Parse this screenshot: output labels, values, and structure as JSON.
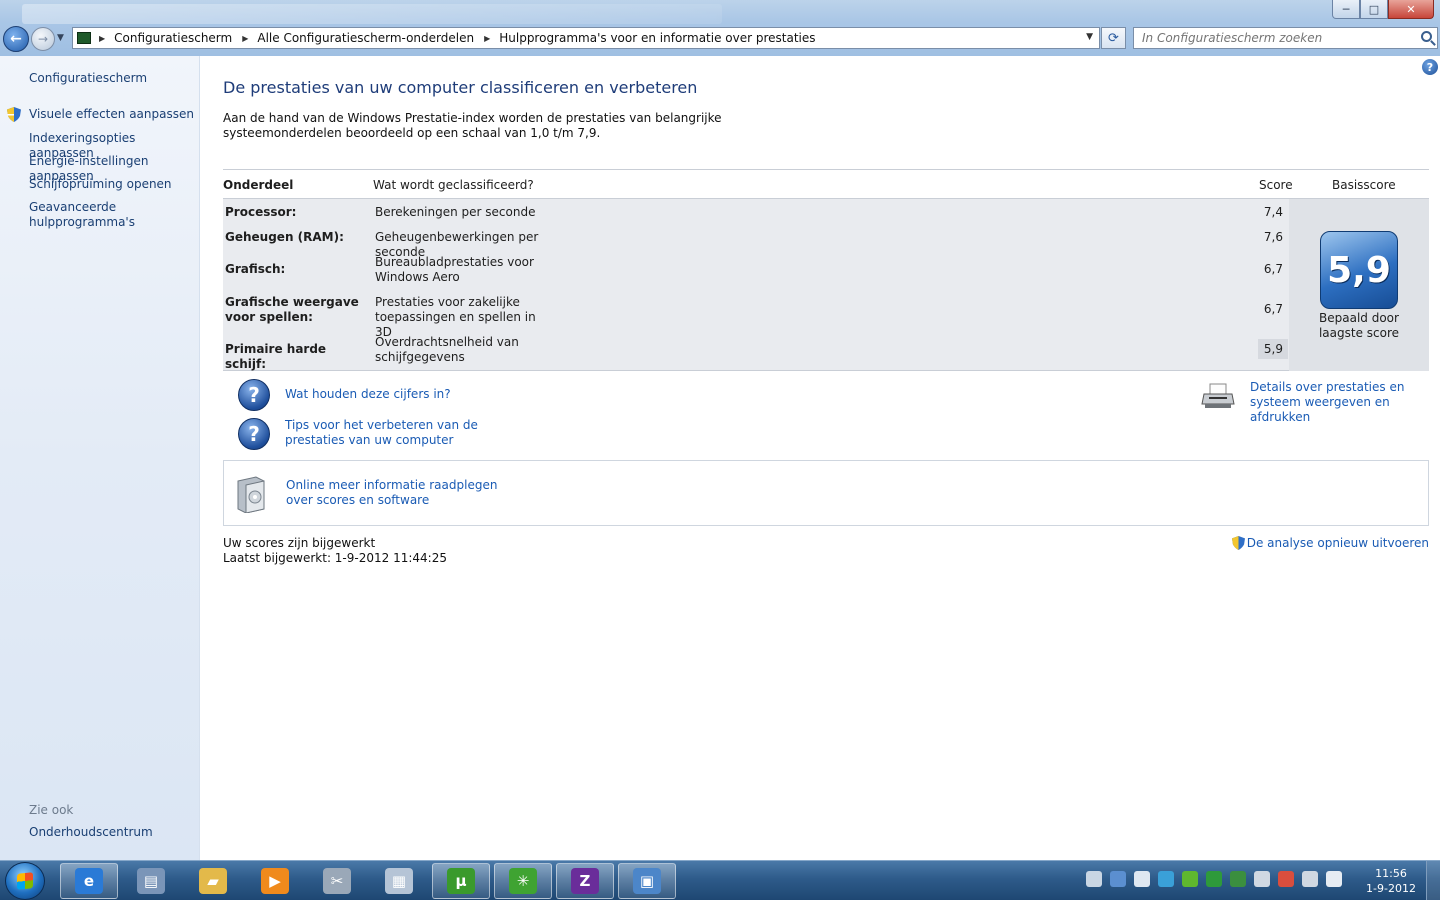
{
  "window": {
    "minimize_label": "─",
    "maximize_label": "□",
    "close_label": "✕"
  },
  "nav": {
    "back_label": "←",
    "forward_label": "→"
  },
  "address": {
    "crumbs": [
      "Configuratiescherm",
      "Alle Configuratiescherm-onderdelen",
      "Hulpprogramma's voor en informatie over prestaties"
    ]
  },
  "search": {
    "placeholder": "In Configuratiescherm zoeken"
  },
  "sidebar": {
    "home": "Configuratiescherm",
    "items": [
      {
        "label": "Visuele effecten aanpassen",
        "shield": true
      },
      {
        "label": "Indexeringsopties aanpassen",
        "shield": false
      },
      {
        "label": "Energie-instellingen aanpassen",
        "shield": false
      },
      {
        "label": "Schijfopruiming openen",
        "shield": false
      },
      {
        "label": "Geavanceerde hulpprogramma's",
        "shield": false
      }
    ],
    "see_also_title": "Zie ook",
    "see_also": [
      "Onderhoudscentrum"
    ]
  },
  "main": {
    "help_label": "?",
    "title": "De prestaties van uw computer classificeren en verbeteren",
    "intro": "Aan de hand van de Windows Prestatie-index worden de prestaties van belangrijke systeemonderdelen beoordeeld op een schaal van 1,0 t/m 7,9.",
    "table": {
      "headers": {
        "component": "Onderdeel",
        "what": "Wat wordt geclassificeerd?",
        "score": "Score",
        "base": "Basisscore"
      },
      "rows": [
        {
          "component": "Processor:",
          "what": "Berekeningen per seconde",
          "score": "7,4"
        },
        {
          "component": "Geheugen (RAM):",
          "what": "Geheugenbewerkingen per seconde",
          "score": "7,6"
        },
        {
          "component": "Grafisch:",
          "what": "Bureaubladprestaties voor Windows Aero",
          "score": "6,7"
        },
        {
          "component": "Grafische weergave voor spellen:",
          "what": "Prestaties voor zakelijke toepassingen en spellen in 3D",
          "score": "6,7"
        },
        {
          "component": "Primaire harde schijf:",
          "what": "Overdrachtsnelheid van schijfgegevens",
          "score": "5,9"
        }
      ],
      "base_score": "5,9",
      "base_caption": "Bepaald door laagste score"
    },
    "links": {
      "what_mean": "Wat houden deze cijfers in?",
      "tips": "Tips voor het verbeteren van de prestaties van uw computer",
      "details": "Details over prestaties en systeem weergeven en afdrukken",
      "online": "Online meer informatie raadplegen over scores en software"
    },
    "status_line1": "Uw scores zijn bijgewerkt",
    "status_line2": "Laatst bijgewerkt: 1-9-2012 11:44:25",
    "rerun": "De analyse opnieuw uitvoeren"
  },
  "taskbar": {
    "clock_time": "11:56",
    "clock_date": "1-9-2012",
    "apps": [
      {
        "name": "internet-explorer",
        "glyph": "e",
        "color": "#2a7ad6"
      },
      {
        "name": "paper-window",
        "glyph": "▤",
        "color": "#7a95b8"
      },
      {
        "name": "explorer-folder",
        "glyph": "▰",
        "color": "#e3b94a"
      },
      {
        "name": "media-player",
        "glyph": "▶",
        "color": "#f08a1c"
      },
      {
        "name": "snipping-tool",
        "glyph": "✂",
        "color": "#9aa8b8"
      },
      {
        "name": "calculator",
        "glyph": "▦",
        "color": "#b5c4d6"
      },
      {
        "name": "utorrent",
        "glyph": "µ",
        "color": "#3a9a2c"
      },
      {
        "name": "green-app",
        "glyph": "✳",
        "color": "#3fa332"
      },
      {
        "name": "cpu-z",
        "glyph": "Z",
        "color": "#6a2d9a"
      },
      {
        "name": "control-panel",
        "glyph": "▣",
        "color": "#4c86c9"
      }
    ],
    "tray": [
      "#c9d6e4",
      "#5b8fd0",
      "#dfe8f2",
      "#3aa0d8",
      "#5fb82e",
      "#2e9a3b",
      "#3b8f3f",
      "#d0d8e2",
      "#d94e3e",
      "#d0d8e2",
      "#e6ecf3"
    ]
  }
}
